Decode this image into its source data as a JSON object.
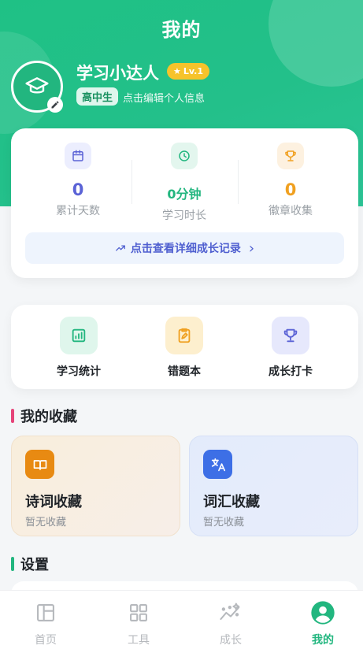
{
  "header": {
    "title": "我的"
  },
  "profile": {
    "name": "学习小达人",
    "level": "Lv.1",
    "level_star": "★",
    "grade": "高中生",
    "edit_hint": "点击编辑个人信息"
  },
  "stats": [
    {
      "value": "0",
      "label": "累计天数",
      "icon": "calendar-icon",
      "color": "#5b63d6"
    },
    {
      "value": "0分钟",
      "label": "学习时长",
      "icon": "clock-icon",
      "color": "#22b67f"
    },
    {
      "value": "0",
      "label": "徽章收集",
      "icon": "trophy-icon",
      "color": "#f0a020"
    }
  ],
  "growth_link": {
    "label": "点击查看详细成长记录",
    "chevron": "›"
  },
  "tools": [
    {
      "label": "学习统计",
      "icon": "chart-icon"
    },
    {
      "label": "错题本",
      "icon": "clipboard-edit-icon"
    },
    {
      "label": "成长打卡",
      "icon": "trophy-icon"
    }
  ],
  "favorites": {
    "title": "我的收藏",
    "items": [
      {
        "title": "诗词收藏",
        "subtitle": "暂无收藏",
        "icon": "book-icon"
      },
      {
        "title": "词汇收藏",
        "subtitle": "暂无收藏",
        "icon": "translate-icon"
      }
    ]
  },
  "settings": {
    "title": "设置"
  },
  "tabbar": [
    {
      "label": "首页",
      "icon": "home-layout-icon",
      "active": false
    },
    {
      "label": "工具",
      "icon": "grid-icon",
      "active": false
    },
    {
      "label": "成长",
      "icon": "trend-icon",
      "active": false
    },
    {
      "label": "我的",
      "icon": "user-icon",
      "active": true
    }
  ],
  "colors": {
    "brand": "#22b67f",
    "accent_purple": "#5b63d6",
    "accent_orange": "#f0a020",
    "accent_pink": "#e6457a"
  }
}
